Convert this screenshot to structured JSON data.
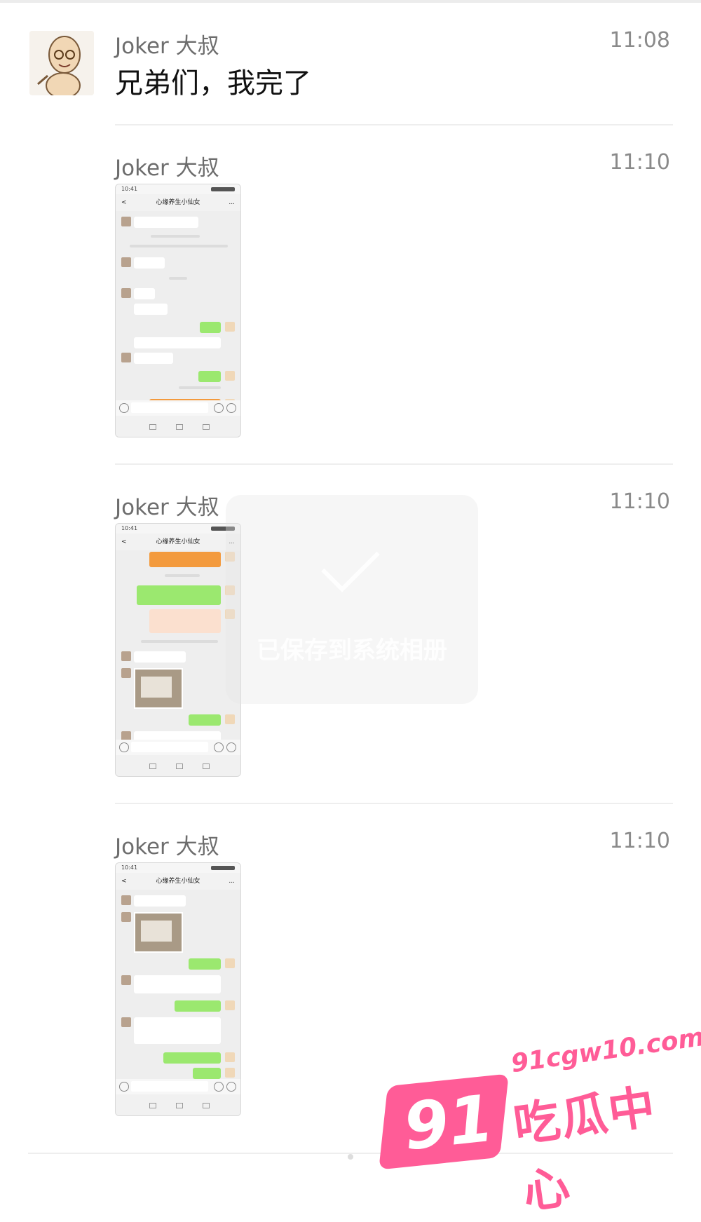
{
  "messages": [
    {
      "sender": "Joker 大叔",
      "time": "11:08",
      "text": "兄弟们，我完了"
    },
    {
      "sender": "Joker 大叔",
      "time": "11:10",
      "thumb": {
        "title": "心缘养生小仙女"
      }
    },
    {
      "sender": "Joker 大叔",
      "time": "11:10",
      "thumb": {
        "title": "心缘养生小仙女"
      }
    },
    {
      "sender": "Joker 大叔",
      "time": "11:10",
      "thumb": {
        "title": "心缘养生小仙女"
      }
    }
  ],
  "thumb_common": {
    "status_time": "10:41",
    "back": "<",
    "more": "..."
  },
  "toast": {
    "text": "已保存到系统相册"
  },
  "watermark": {
    "number": "91",
    "url": "91cgw10.com",
    "name": "吃瓜中心"
  },
  "colors": {
    "green_bubble": "#9be86f",
    "watermark_pink": "#ff5c97"
  }
}
